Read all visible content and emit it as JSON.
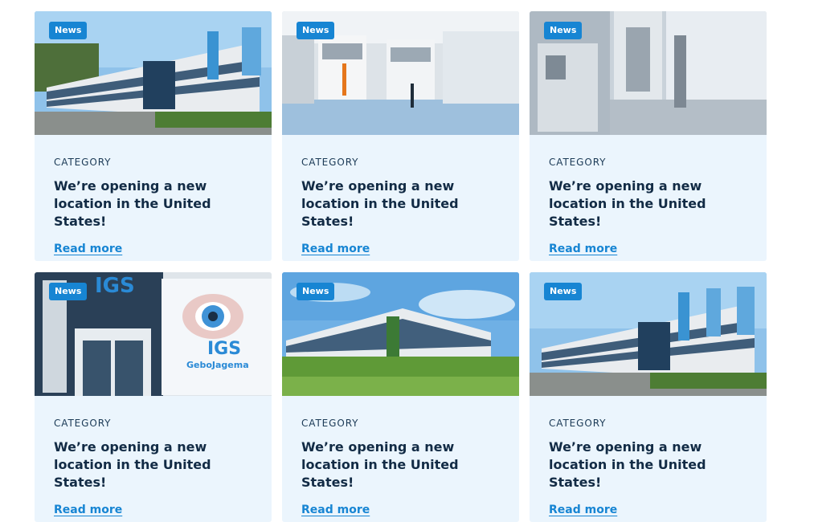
{
  "cards": [
    {
      "badge": "News",
      "category": "CATEGORY",
      "title": "We’re opening a new location in the United States!",
      "link": "Read more"
    },
    {
      "badge": "News",
      "category": "CATEGORY",
      "title": "We’re opening a new location in the United States!",
      "link": "Read more"
    },
    {
      "badge": "News",
      "category": "CATEGORY",
      "title": "We’re opening a new location in the United States!",
      "link": "Read more"
    },
    {
      "badge": "News",
      "category": "CATEGORY",
      "title": "We’re opening a new location in the United States!",
      "link": "Read more"
    },
    {
      "badge": "News",
      "category": "CATEGORY",
      "title": "We’re opening a new location in the United States!",
      "link": "Read more"
    },
    {
      "badge": "News",
      "category": "CATEGORY",
      "title": "We’re opening a new location in the United States!",
      "link": "Read more"
    }
  ],
  "logo": {
    "line1": "IGS",
    "line2": "GeboJagema"
  },
  "colors": {
    "accent": "#1785d3",
    "card_bg": "#ebf5fd",
    "title": "#122b45"
  }
}
